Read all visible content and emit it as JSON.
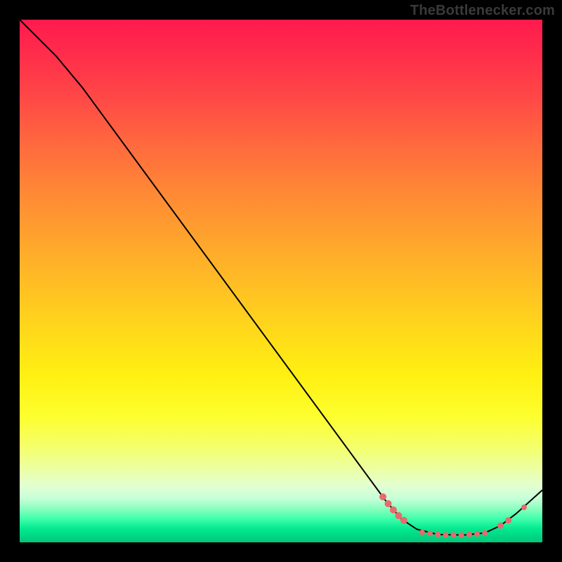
{
  "attribution": "TheBottlenecker.com",
  "chart_data": {
    "type": "line",
    "title": "",
    "xlabel": "",
    "ylabel": "",
    "xlim": [
      0,
      100
    ],
    "ylim": [
      0,
      100
    ],
    "curve": [
      {
        "x": 0,
        "y": 100
      },
      {
        "x": 7,
        "y": 93
      },
      {
        "x": 12,
        "y": 87
      },
      {
        "x": 70,
        "y": 8
      },
      {
        "x": 73,
        "y": 4.5
      },
      {
        "x": 76,
        "y": 2.5
      },
      {
        "x": 80,
        "y": 1.5
      },
      {
        "x": 85,
        "y": 1.4
      },
      {
        "x": 89,
        "y": 1.8
      },
      {
        "x": 92,
        "y": 3.2
      },
      {
        "x": 95,
        "y": 5.5
      },
      {
        "x": 100,
        "y": 10
      }
    ],
    "markers": [
      {
        "x": 69.5,
        "y": 8.7,
        "r": 5
      },
      {
        "x": 70.5,
        "y": 7.4,
        "r": 5
      },
      {
        "x": 71.5,
        "y": 6.2,
        "r": 5
      },
      {
        "x": 72.5,
        "y": 5.1,
        "r": 5
      },
      {
        "x": 73.5,
        "y": 4.2,
        "r": 5
      },
      {
        "x": 77.0,
        "y": 1.9,
        "r": 4
      },
      {
        "x": 78.5,
        "y": 1.7,
        "r": 4
      },
      {
        "x": 80.0,
        "y": 1.5,
        "r": 4
      },
      {
        "x": 81.5,
        "y": 1.4,
        "r": 4
      },
      {
        "x": 83.0,
        "y": 1.4,
        "r": 4
      },
      {
        "x": 84.5,
        "y": 1.4,
        "r": 4
      },
      {
        "x": 86.0,
        "y": 1.5,
        "r": 4
      },
      {
        "x": 87.5,
        "y": 1.6,
        "r": 4
      },
      {
        "x": 89.0,
        "y": 1.8,
        "r": 4
      },
      {
        "x": 92.0,
        "y": 3.2,
        "r": 4.5
      },
      {
        "x": 93.5,
        "y": 4.2,
        "r": 4.5
      },
      {
        "x": 96.5,
        "y": 6.7,
        "r": 4
      }
    ],
    "marker_color": "#e86a6d",
    "curve_color": "#000000",
    "background_gradient": {
      "top": "#ff1a4d",
      "mid_upper": "#ffb029",
      "mid_lower": "#fdff2e",
      "bottom": "#00c879"
    }
  }
}
